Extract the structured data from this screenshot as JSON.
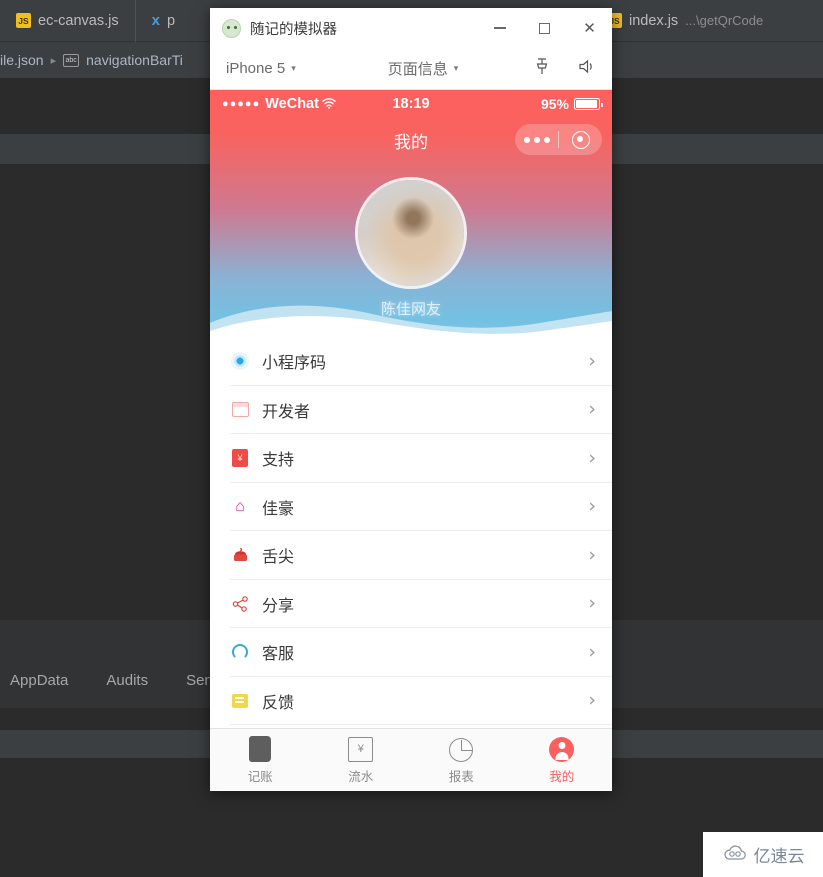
{
  "ide": {
    "tabs": [
      {
        "label": "ec-canvas.js",
        "icon": "js-file-icon",
        "suffix": ""
      },
      {
        "label": "p",
        "icon": "css-file-icon",
        "suffix": ""
      },
      {
        "label": "index.js",
        "icon": "js-file-icon",
        "suffix": "...\\getQrCode"
      }
    ],
    "breadcrumb": {
      "file": "ile.json",
      "separator": "▸",
      "badge": "abc",
      "node": "navigationBarTi"
    },
    "status_items": [
      "AppData",
      "Audits",
      "Sensor"
    ]
  },
  "simulator": {
    "title": "随记的模拟器",
    "window_controls": {
      "minimize": "—",
      "maximize": "□",
      "close": "✕"
    },
    "toolbar": {
      "device": "iPhone 5",
      "device_caret": "▾",
      "page_info": "页面信息",
      "page_caret": "▾",
      "pin_icon": "pin-icon",
      "volume_icon": "volume-icon"
    }
  },
  "phone": {
    "statusbar": {
      "signal_dots": "●●●●●",
      "carrier": "WeChat",
      "wifi_icon": "wifi-icon",
      "time": "18:19",
      "battery_percent": "95%"
    },
    "navbar": {
      "title": "我的",
      "capsule": {
        "more_icon": "more-dots-icon",
        "target_icon": "target-circle-icon"
      }
    },
    "profile": {
      "avatar_alt": "user-avatar",
      "nickname": "陈佳网友"
    },
    "menu": [
      {
        "label": "小程序码",
        "icon": "qrcode-icon",
        "arrow": "›"
      },
      {
        "label": "开发者",
        "icon": "developer-icon",
        "arrow": "›"
      },
      {
        "label": "支持",
        "icon": "redpacket-icon",
        "arrow": "›"
      },
      {
        "label": "佳豪",
        "icon": "home-icon",
        "arrow": "›"
      },
      {
        "label": "舌尖",
        "icon": "cake-icon",
        "arrow": "›"
      },
      {
        "label": "分享",
        "icon": "share-icon",
        "arrow": "›"
      },
      {
        "label": "客服",
        "icon": "service-icon",
        "arrow": "›"
      },
      {
        "label": "反馈",
        "icon": "feedback-icon",
        "arrow": "›"
      }
    ],
    "tabbar": [
      {
        "label": "记账",
        "icon": "book-icon",
        "active": false
      },
      {
        "label": "流水",
        "icon": "flow-icon",
        "active": false
      },
      {
        "label": "报表",
        "icon": "chart-icon",
        "active": false
      },
      {
        "label": "我的",
        "icon": "person-icon",
        "active": true
      }
    ]
  },
  "watermark": {
    "icon": "cloud-icon",
    "text": "亿速云"
  },
  "colors": {
    "accent": "#fd5f5f",
    "hero_top": "#fd5f5f",
    "hero_bottom": "#74c0e2",
    "ide_bg": "#2b2b2b",
    "ide_panel": "#3c3f41"
  }
}
